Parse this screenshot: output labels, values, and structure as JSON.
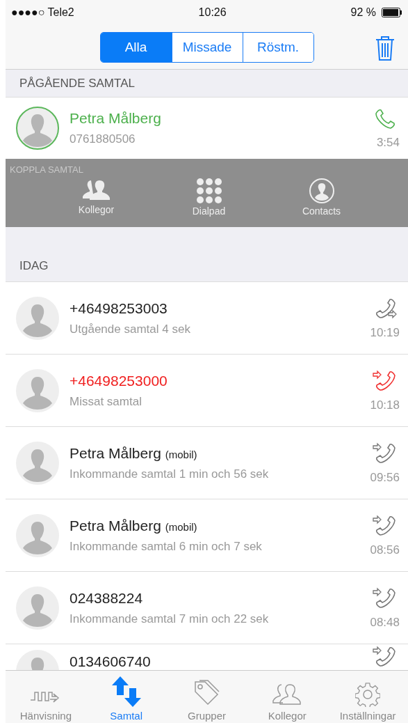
{
  "status_bar": {
    "carrier": "●●●●○ Tele2",
    "time": "10:26",
    "battery": "92 %"
  },
  "segments": [
    {
      "label": "Alla",
      "selected": true
    },
    {
      "label": "Missade",
      "selected": false
    },
    {
      "label": "Röstm.",
      "selected": false
    }
  ],
  "ongoing": {
    "header": "PÅGÅENDE SAMTAL",
    "name": "Petra Målberg",
    "number": "0761880506",
    "duration": "3:54"
  },
  "transfer": {
    "header": "KOPPLA SAMTAL",
    "actions": [
      {
        "kind": "colleagues",
        "label": "Kollegor"
      },
      {
        "kind": "dialpad",
        "label": "Dialpad"
      },
      {
        "kind": "contacts",
        "label": "Contacts"
      }
    ]
  },
  "today": {
    "header": "IDAG",
    "calls": [
      {
        "kind": "outgoing",
        "name": "+46498253003",
        "detail": "Utgående samtal 4 sek",
        "time": "10:19"
      },
      {
        "kind": "missed",
        "name": "+46498253000",
        "detail": "Missat samtal",
        "time": "10:18"
      },
      {
        "kind": "incoming",
        "name": "Petra Målberg",
        "qualifier": "(mobil)",
        "detail": "Inkommande samtal 1 min och 56 sek",
        "time": "09:56"
      },
      {
        "kind": "incoming",
        "name": "Petra Målberg",
        "qualifier": "(mobil)",
        "detail": "Inkommande samtal 6 min och 7 sek",
        "time": "08:56"
      },
      {
        "kind": "incoming",
        "name": "024388224",
        "detail": "Inkommande samtal 7 min och 22 sek",
        "time": "08:48"
      },
      {
        "kind": "incoming",
        "name": "0134606740"
      }
    ]
  },
  "tab_bar": [
    {
      "kind": "redirect",
      "label": "Hänvisning",
      "selected": false
    },
    {
      "kind": "calls",
      "label": "Samtal",
      "selected": true
    },
    {
      "kind": "groups",
      "label": "Grupper",
      "selected": false
    },
    {
      "kind": "colleagues",
      "label": "Kollegor",
      "selected": false
    },
    {
      "kind": "settings",
      "label": "Inställningar",
      "selected": false
    }
  ]
}
